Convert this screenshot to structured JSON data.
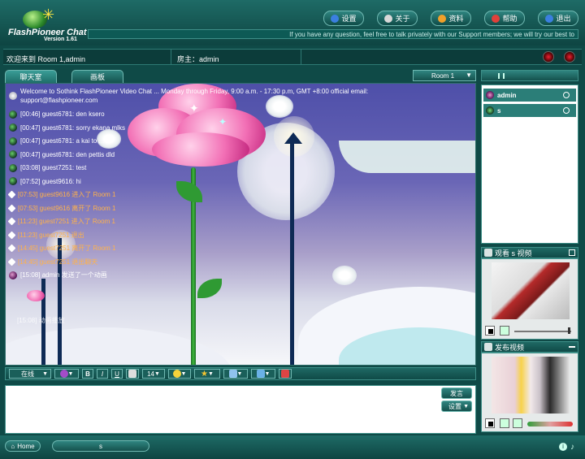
{
  "app": {
    "logo_title": "FlashPioneer Chat",
    "logo_version": "Version 1.61"
  },
  "topnav": [
    {
      "label": "设置",
      "icon": "settings-icon",
      "color": "#3b7fe0"
    },
    {
      "label": "关于",
      "icon": "about-icon",
      "color": "#d9d9d9"
    },
    {
      "label": "资料",
      "icon": "profile-icon",
      "color": "#f0a02a"
    },
    {
      "label": "帮助",
      "icon": "help-icon",
      "color": "#e0403a"
    },
    {
      "label": "退出",
      "icon": "exit-icon",
      "color": "#3b7fe0"
    }
  ],
  "marquee": "If you have any question, feel free to talk privately with our Support members; we will try our best to",
  "infobar": {
    "welcome": "欢迎来到 Room 1,admin",
    "host": "房主：admin"
  },
  "tabs": [
    {
      "label": "聊天室"
    },
    {
      "label": "画板"
    }
  ],
  "room_select": "Room 1",
  "chat": {
    "welcome_text": "Welcome to Sothink FlashPioneer Video Chat ... Monday through Friday, 9:00 a.m. - 17:30 p.m, GMT +8:00 official email:",
    "welcome_email": "support@flashpioneer.com",
    "messages": [
      {
        "text": "[00:46] guest6781: den ksero",
        "kind": "usr",
        "avatar": "user-green"
      },
      {
        "text": "[00:47] guest6781: sorry ekana mlks",
        "kind": "usr",
        "avatar": "user-green"
      },
      {
        "text": "[00:47] guest6781: a kai to ... ai",
        "kind": "usr",
        "avatar": "user-green"
      },
      {
        "text": "[00:47] guest6781: den pettis dld",
        "kind": "usr",
        "avatar": "user-green"
      },
      {
        "text": "[03:08] guest7251: test",
        "kind": "usr",
        "avatar": "user-green"
      },
      {
        "text": "[07:52] guest9616: hi",
        "kind": "usr",
        "avatar": "user-green"
      },
      {
        "text": "[07:53] guest9616 进入了 Room 1",
        "kind": "sys",
        "avatar": "diamond"
      },
      {
        "text": "[07:53] guest9616 离开了 Room 1",
        "kind": "sys",
        "avatar": "diamond"
      },
      {
        "text": "[11:23] guest7251 进入了 Room 1",
        "kind": "sys",
        "avatar": "diamond"
      },
      {
        "text": "[11:23] guest7251 退出",
        "kind": "sys",
        "avatar": "diamond"
      },
      {
        "text": "[14:45] guest7251 离开了 Room 1",
        "kind": "sys",
        "avatar": "diamond"
      },
      {
        "text": "[14:45] guest7251 退出聊天",
        "kind": "sys",
        "avatar": "diamond"
      },
      {
        "text": "[15:08] admin 发送了一个动画",
        "kind": "usr",
        "avatar": "user-purple"
      }
    ],
    "footer_note": "[15:08] 动画播放"
  },
  "toolbar": {
    "status": "在线",
    "bold": "B",
    "italic": "I",
    "underline": "U",
    "font_size": "14"
  },
  "input": {
    "send": "发言",
    "settings": "设置"
  },
  "users": [
    {
      "name": "admin",
      "avatar": "user-purple",
      "selected": true
    },
    {
      "name": "s",
      "avatar": "user-green",
      "selected": true
    }
  ],
  "video_panels": {
    "watch_title": "观看 s 视频",
    "publish_title": "发布视频"
  },
  "bottom": {
    "home": "Home",
    "tab": "s"
  }
}
